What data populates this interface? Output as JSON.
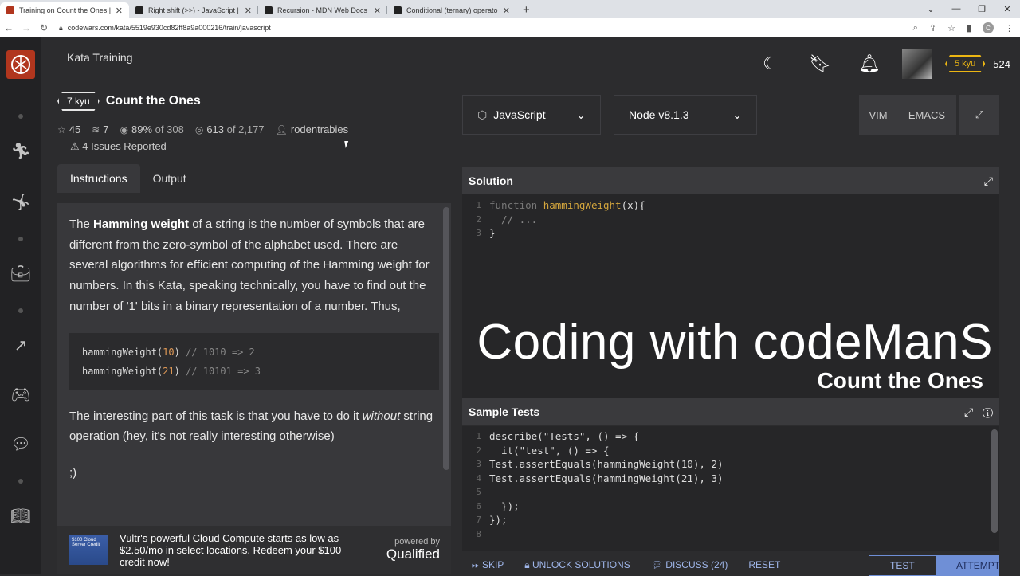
{
  "browser": {
    "tabs": [
      {
        "label": "Training on Count the Ones | Co",
        "color": "#b1361e",
        "active": true
      },
      {
        "label": "Right shift (>>) - JavaScript | MD",
        "color": "#222"
      },
      {
        "label": "Recursion - MDN Web Docs Glos",
        "color": "#222"
      },
      {
        "label": "Conditional (ternary) operator - J",
        "color": "#222"
      }
    ],
    "url": "codewars.com/kata/5519e930cd82ff8a9a000216/train/javascript"
  },
  "header": {
    "title": "Kata Training",
    "rank_badge": "5 kyu",
    "honor": "524"
  },
  "kata": {
    "rank": "7 kyu",
    "title": "Count the Ones",
    "stars": "45",
    "collections": "7",
    "satisfaction_pct": "89%",
    "satisfaction_of": "of 308",
    "completed": "613",
    "completed_of": "of 2,177",
    "author": "rodentrabies",
    "issues": "4 Issues Reported"
  },
  "tabs": {
    "instructions": "Instructions",
    "output": "Output"
  },
  "instructions": {
    "p1_pre": "The ",
    "p1_bold": "Hamming weight",
    "p1_post": " of a string is the number of symbols that are different from the zero-symbol of the alphabet used. There are several algorithms for efficient computing of the Hamming weight for numbers. In this Kata, speaking technically, you have to find out the number of '1' bits in a binary representation of a number. Thus,",
    "code": [
      {
        "fn": "hammingWeight(",
        "num": "10",
        "close": ")",
        "comment": " // 1010  => 2"
      },
      {
        "fn": "hammingWeight(",
        "num": "21",
        "close": ")",
        "comment": " // 10101 => 3"
      }
    ],
    "p2_pre": "The interesting part of this task is that you have to do it ",
    "p2_em": "without",
    "p2_post": " string operation (hey, it's not really interesting otherwise)",
    "p3": ";)"
  },
  "ad": {
    "text": "Vultr's powerful Cloud Compute starts as low as $2.50/mo in select locations. Redeem your $100 credit now!",
    "img_text": "$100 Cloud Server Credit",
    "powered_by": "powered by",
    "brand": "Qualified"
  },
  "editor": {
    "language": "JavaScript",
    "version": "Node v8.1.3",
    "modes": [
      "VIM",
      "EMACS"
    ],
    "solution_title": "Solution",
    "solution_lines": [
      "1",
      "2",
      "3"
    ],
    "sol_l1_kw": "function ",
    "sol_l1_fn": "hammingWeight",
    "sol_l1_rest": "(x){",
    "sol_l2": "  // ...",
    "sol_l3": "}",
    "overlay_title": "Coding with codeManS",
    "overlay_sub": "Count the Ones",
    "tests_title": "Sample Tests",
    "tests_lines": [
      {
        "n": "1",
        "t": "describe(\"Tests\", () => {"
      },
      {
        "n": "2",
        "t": "  it(\"test\", () => {"
      },
      {
        "n": "3",
        "t": "Test.assertEquals(hammingWeight(10), 2)"
      },
      {
        "n": "4",
        "t": "Test.assertEquals(hammingWeight(21), 3)"
      },
      {
        "n": "5",
        "t": ""
      },
      {
        "n": "6",
        "t": "  });"
      },
      {
        "n": "7",
        "t": "});"
      },
      {
        "n": "8",
        "t": ""
      }
    ]
  },
  "actions": {
    "skip": "SKIP",
    "unlock": "UNLOCK SOLUTIONS",
    "discuss": "DISCUSS (24)",
    "reset": "RESET",
    "test": "TEST",
    "attempt": "ATTEMPT"
  }
}
